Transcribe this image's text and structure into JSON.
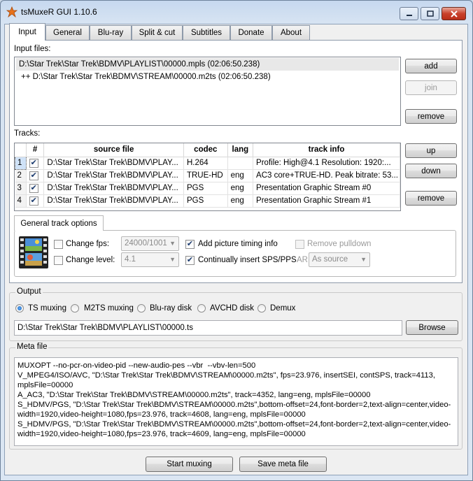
{
  "window": {
    "title": "tsMuxeR GUI 1.10.6"
  },
  "tabs": [
    "Input",
    "General",
    "Blu-ray",
    "Split & cut",
    "Subtitles",
    "Donate",
    "About"
  ],
  "input_files": {
    "label": "Input files:",
    "files": [
      "D:\\Star Trek\\Star Trek\\BDMV\\PLAYLIST\\00000.mpls (02:06:50.238)",
      "++ D:\\Star Trek\\Star Trek\\BDMV\\STREAM\\00000.m2ts (02:06:50.238)"
    ],
    "buttons": {
      "add": "add",
      "join": "join",
      "remove": "remove"
    }
  },
  "tracks": {
    "label": "Tracks:",
    "columns": [
      "#",
      "source file",
      "codec",
      "lang",
      "track info"
    ],
    "rows": [
      {
        "num": "1",
        "source": "D:\\Star Trek\\Star Trek\\BDMV\\PLAY...",
        "codec": "H.264",
        "lang": "",
        "info": "Profile: High@4.1  Resolution: 1920:..."
      },
      {
        "num": "2",
        "source": "D:\\Star Trek\\Star Trek\\BDMV\\PLAY...",
        "codec": "TRUE-HD",
        "lang": "eng",
        "info": "AC3 core+TRUE-HD. Peak bitrate: 53..."
      },
      {
        "num": "3",
        "source": "D:\\Star Trek\\Star Trek\\BDMV\\PLAY...",
        "codec": "PGS",
        "lang": "eng",
        "info": "Presentation Graphic Stream #0"
      },
      {
        "num": "4",
        "source": "D:\\Star Trek\\Star Trek\\BDMV\\PLAY...",
        "codec": "PGS",
        "lang": "eng",
        "info": "Presentation Graphic Stream #1"
      }
    ],
    "buttons": {
      "up": "up",
      "down": "down",
      "remove": "remove"
    }
  },
  "track_options": {
    "tab": "General track options",
    "change_fps": "Change fps:",
    "fps_value": "24000/1001",
    "change_level": "Change level:",
    "level_value": "4.1",
    "add_picture_timing": "Add picture timing info",
    "insert_sps": "Continually insert SPS/PPS",
    "remove_pulldown": "Remove pulldown",
    "ar_label": "AR",
    "ar_value": "As source"
  },
  "output": {
    "label": "Output",
    "options": [
      "TS muxing",
      "M2TS muxing",
      "Blu-ray disk",
      "AVCHD disk",
      "Demux"
    ],
    "selected": "TS muxing",
    "path": "D:\\Star Trek\\Star Trek\\BDMV\\PLAYLIST\\00000.ts",
    "browse": "Browse"
  },
  "meta": {
    "label": "Meta file",
    "lines": [
      "MUXOPT --no-pcr-on-video-pid --new-audio-pes --vbr  --vbv-len=500",
      "V_MPEG4/ISO/AVC, \"D:\\Star Trek\\Star Trek\\BDMV\\STREAM\\00000.m2ts\", fps=23.976, insertSEI, contSPS, track=4113,",
      "mplsFile=00000",
      "A_AC3, \"D:\\Star Trek\\Star Trek\\BDMV\\STREAM\\00000.m2ts\", track=4352, lang=eng, mplsFile=00000",
      "S_HDMV/PGS, \"D:\\Star Trek\\Star Trek\\BDMV\\STREAM\\00000.m2ts\",bottom-offset=24,font-border=2,text-align=center,video-",
      "width=1920,video-height=1080,fps=23.976, track=4608, lang=eng, mplsFile=00000",
      "S_HDMV/PGS, \"D:\\Star Trek\\Star Trek\\BDMV\\STREAM\\00000.m2ts\",bottom-offset=24,font-border=2,text-align=center,video-",
      "width=1920,video-height=1080,fps=23.976, track=4609, lang=eng, mplsFile=00000"
    ]
  },
  "bottom_buttons": {
    "start": "Start muxing",
    "save_meta": "Save meta file"
  }
}
